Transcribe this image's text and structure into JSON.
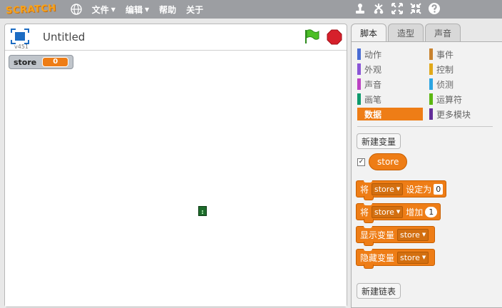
{
  "menu": {
    "logo": "SCRATCH",
    "file": "文件",
    "edit": "编辑",
    "help": "帮助",
    "about": "关于"
  },
  "stage": {
    "title": "Untitled",
    "version": "v451",
    "monitor": {
      "name": "store",
      "value": "0"
    }
  },
  "tabs": [
    "脚本",
    "造型",
    "声音"
  ],
  "categories": {
    "motion": {
      "label": "动作",
      "color": "#4a6cd4"
    },
    "events": {
      "label": "事件",
      "color": "#c88330"
    },
    "looks": {
      "label": "外观",
      "color": "#8a55d7"
    },
    "control": {
      "label": "控制",
      "color": "#e1a91a"
    },
    "sound": {
      "label": "声音",
      "color": "#bb42c3"
    },
    "sensing": {
      "label": "侦测",
      "color": "#2ca5e2"
    },
    "pen": {
      "label": "画笔",
      "color": "#0e9a6c"
    },
    "operators": {
      "label": "运算符",
      "color": "#5cb712"
    },
    "data": {
      "label": "数据",
      "color": "#ee7d16"
    },
    "more": {
      "label": "更多模块",
      "color": "#632d99"
    }
  },
  "palette": {
    "new_variable": "新建变量",
    "variable_name": "store",
    "set_prefix": "将",
    "set_suffix": "设定为",
    "set_value": "0",
    "change_prefix": "将",
    "change_suffix": "增加",
    "change_value": "1",
    "show_label": "显示变量",
    "hide_label": "隐藏变量",
    "new_list": "新建链表"
  }
}
